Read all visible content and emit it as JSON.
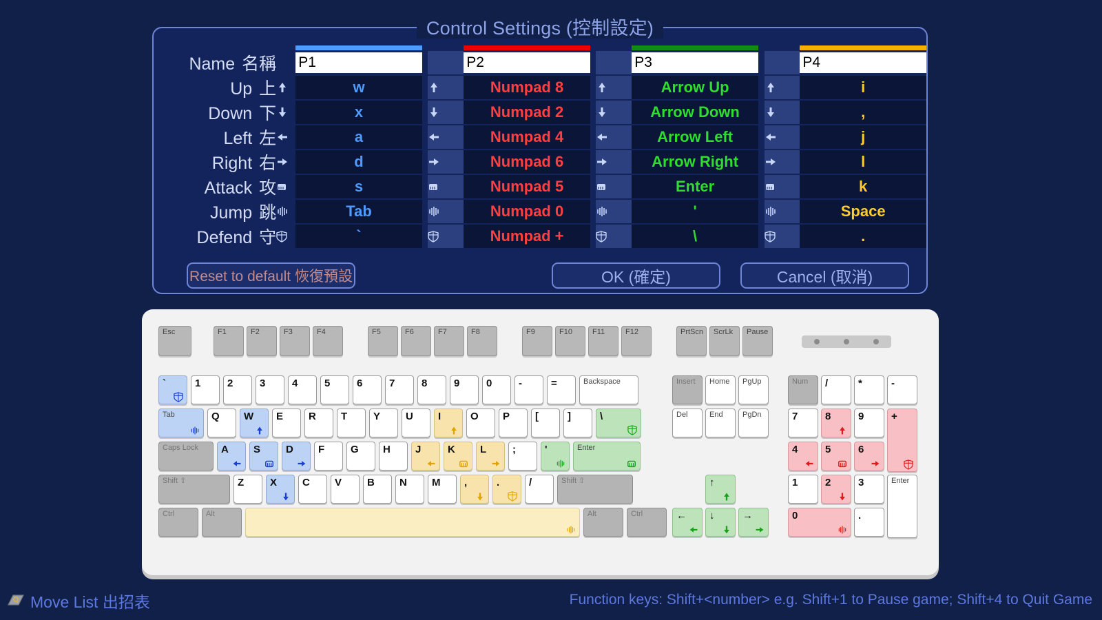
{
  "dialog": {
    "title": "Control Settings (控制設定)",
    "rows": [
      {
        "en": "Name",
        "zh": "名稱",
        "icon": ""
      },
      {
        "en": "Up",
        "zh": "上",
        "icon": "arrow-up-icon"
      },
      {
        "en": "Down",
        "zh": "下",
        "icon": "arrow-down-icon"
      },
      {
        "en": "Left",
        "zh": "左",
        "icon": "arrow-left-icon"
      },
      {
        "en": "Right",
        "zh": "右",
        "icon": "arrow-right-icon"
      },
      {
        "en": "Attack",
        "zh": "攻",
        "icon": "fist-icon"
      },
      {
        "en": "Jump",
        "zh": "跳",
        "icon": "jump-icon"
      },
      {
        "en": "Defend",
        "zh": "守",
        "icon": "shield-icon"
      }
    ],
    "players": [
      {
        "id": "p1",
        "accent": "#4f9bff",
        "name": "P1",
        "keys": {
          "up": "w",
          "down": "x",
          "left": "a",
          "right": "d",
          "attack": "s",
          "jump": "Tab",
          "defend": "`"
        }
      },
      {
        "id": "p2",
        "accent": "#ee0000",
        "name": "P2",
        "keys": {
          "up": "Numpad 8",
          "down": "Numpad 2",
          "left": "Numpad 4",
          "right": "Numpad 6",
          "attack": "Numpad 5",
          "jump": "Numpad 0",
          "defend": "Numpad +"
        }
      },
      {
        "id": "p3",
        "accent": "#128c12",
        "name": "P3",
        "keys": {
          "up": "Arrow Up",
          "down": "Arrow Down",
          "left": "Arrow Left",
          "right": "Arrow Right",
          "attack": "Enter",
          "jump": "'",
          "defend": "\\"
        }
      },
      {
        "id": "p4",
        "accent": "#f5b000",
        "name": "P4",
        "keys": {
          "up": "i",
          "down": ",",
          "left": "j",
          "right": "l",
          "attack": "k",
          "jump": "Space",
          "defend": "."
        }
      }
    ],
    "buttons": {
      "reset": "Reset to default 恢復預設",
      "ok": "OK (確定)",
      "cancel": "Cancel (取消)"
    }
  },
  "keyboard": {
    "esc": "Esc",
    "fn_group_1": [
      "F1",
      "F2",
      "F3",
      "F4"
    ],
    "fn_group_2": [
      "F5",
      "F6",
      "F7",
      "F8"
    ],
    "fn_group_3": [
      "F9",
      "F10",
      "F11",
      "F12"
    ],
    "fn_group_4": [
      "PrtScn",
      "ScrLk",
      "Pause"
    ],
    "row_num": [
      "`",
      "1",
      "2",
      "3",
      "4",
      "5",
      "6",
      "7",
      "8",
      "9",
      "0",
      "-",
      "=",
      "Backspace"
    ],
    "row_qwerty": [
      "Tab",
      "Q",
      "W",
      "E",
      "R",
      "T",
      "Y",
      "U",
      "I",
      "O",
      "P",
      "[",
      "]",
      "\\"
    ],
    "row_asdf": [
      "Caps Lock",
      "A",
      "S",
      "D",
      "F",
      "G",
      "H",
      "J",
      "K",
      "L",
      ";",
      "'",
      "Enter"
    ],
    "row_zxcv": [
      "Shift ⇧",
      "Z",
      "X",
      "C",
      "V",
      "B",
      "N",
      "M",
      ",",
      ".",
      "/",
      "Shift ⇧"
    ],
    "row_bottom": [
      "Ctrl",
      "Alt",
      "",
      "Alt",
      "Ctrl"
    ],
    "nav": [
      "Insert",
      "Home",
      "PgUp",
      "Del",
      "End",
      "PgDn"
    ],
    "arrows": [
      "↑",
      "←",
      "↓",
      "→"
    ],
    "numpad": [
      "Num",
      "/",
      "*",
      "-",
      "7",
      "8",
      "9",
      "+",
      "4",
      "5",
      "6",
      "1",
      "2",
      "3",
      "Enter",
      "0",
      "."
    ]
  },
  "footer": {
    "move_list": "Move List 出招表",
    "fn_hint": "Function keys: Shift+<number>   e.g. Shift+1 to Pause game; Shift+4 to Quit Game"
  }
}
